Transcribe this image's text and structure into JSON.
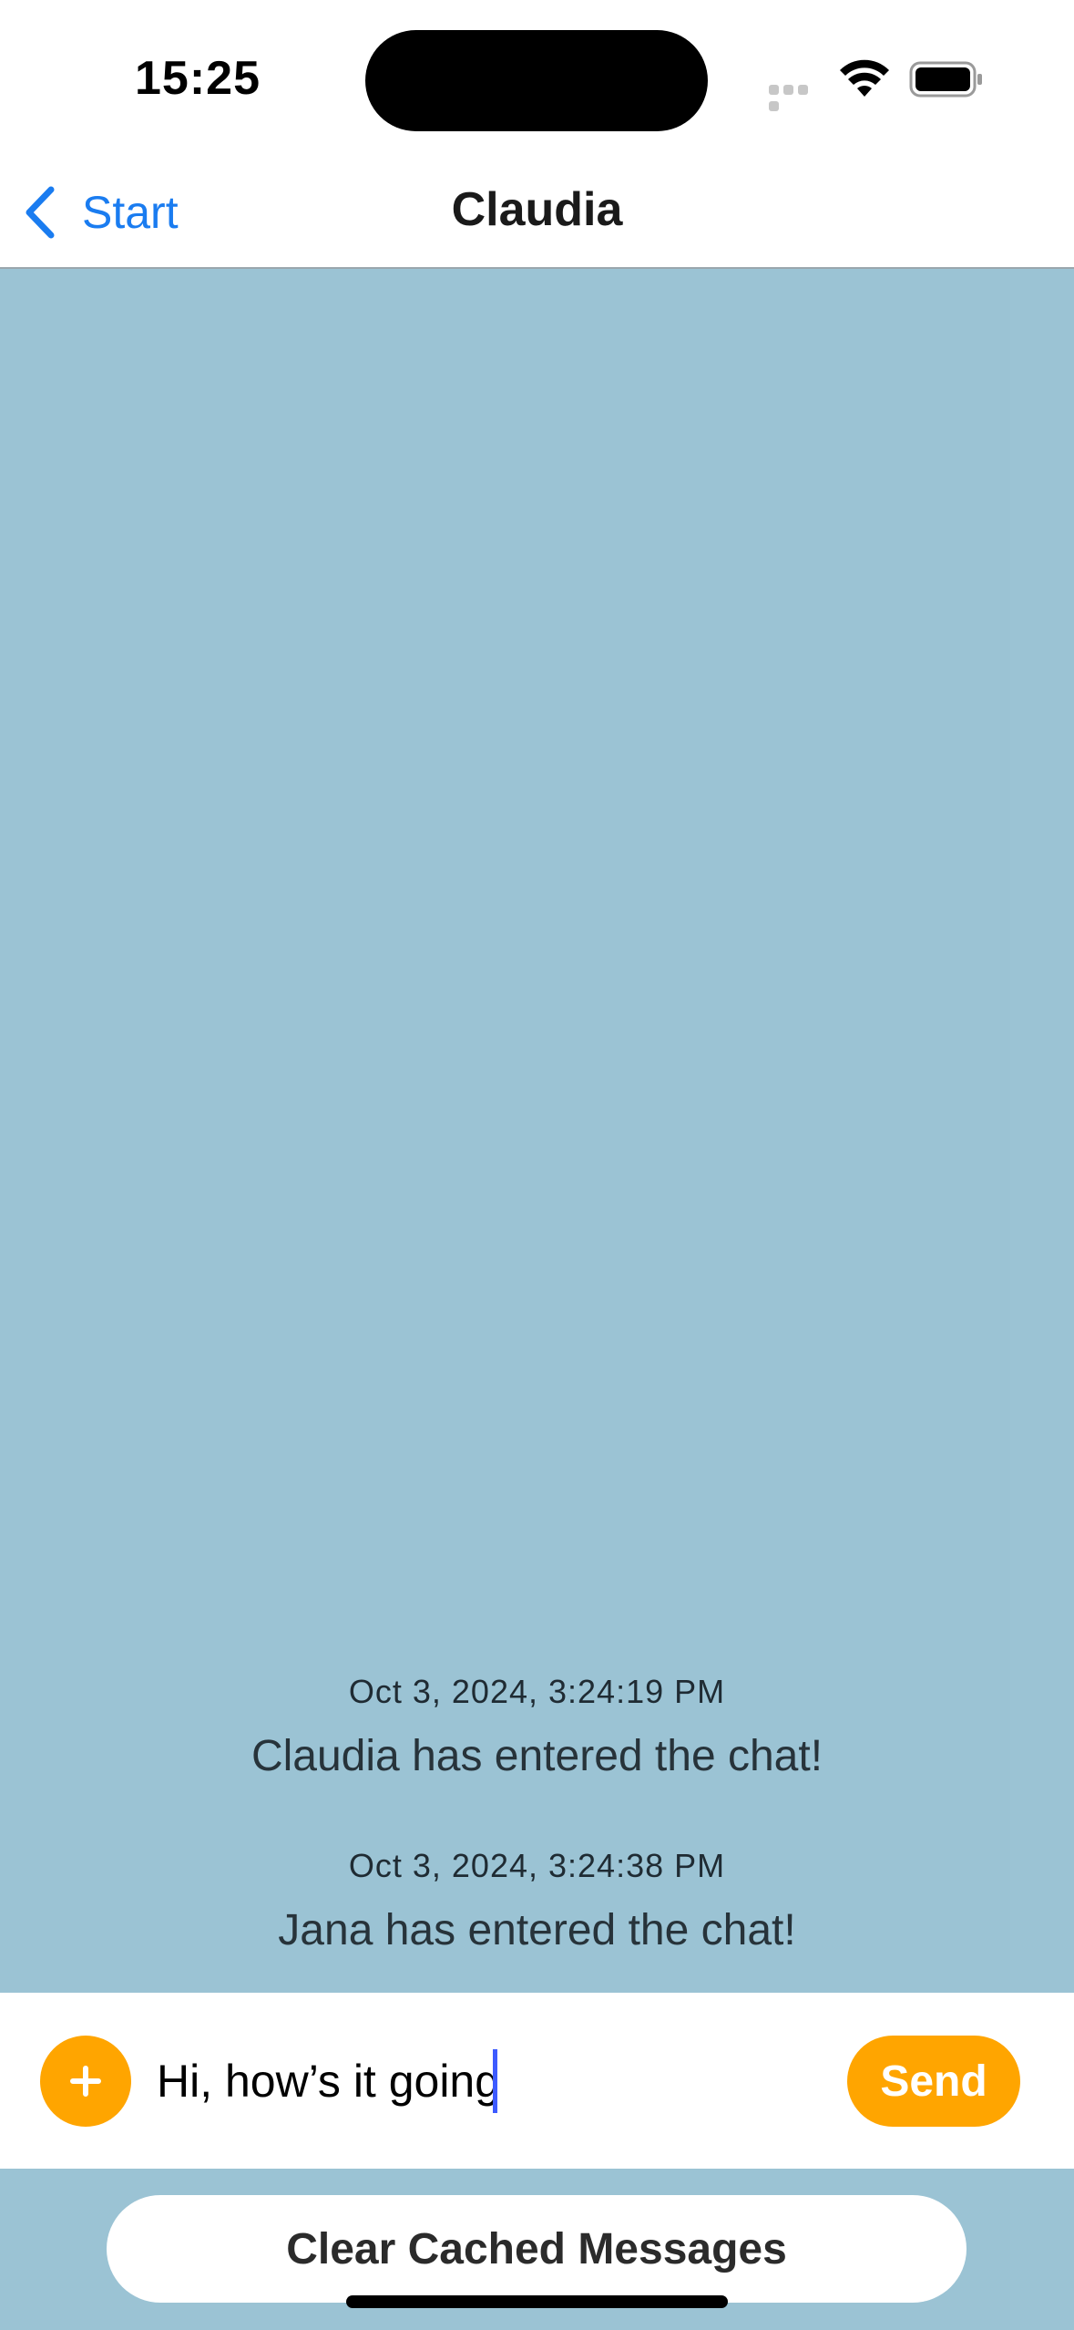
{
  "status_bar": {
    "time": "15:25"
  },
  "nav": {
    "back_label": "Start",
    "title": "Claudia"
  },
  "messages": [
    {
      "timestamp": "Oct 3, 2024, 3:24:19 PM",
      "text": "Claudia has entered the chat!"
    },
    {
      "timestamp": "Oct 3, 2024, 3:24:38 PM",
      "text": "Jana has entered the chat!"
    }
  ],
  "composer": {
    "add_icon": "plus-icon",
    "input_value": "Hi, how’s it going",
    "send_label": "Send"
  },
  "footer": {
    "clear_label": "Clear Cached Messages"
  },
  "colors": {
    "accent": "#ffa500",
    "link": "#1a7cf0",
    "chat_background": "#9bc3d4"
  }
}
